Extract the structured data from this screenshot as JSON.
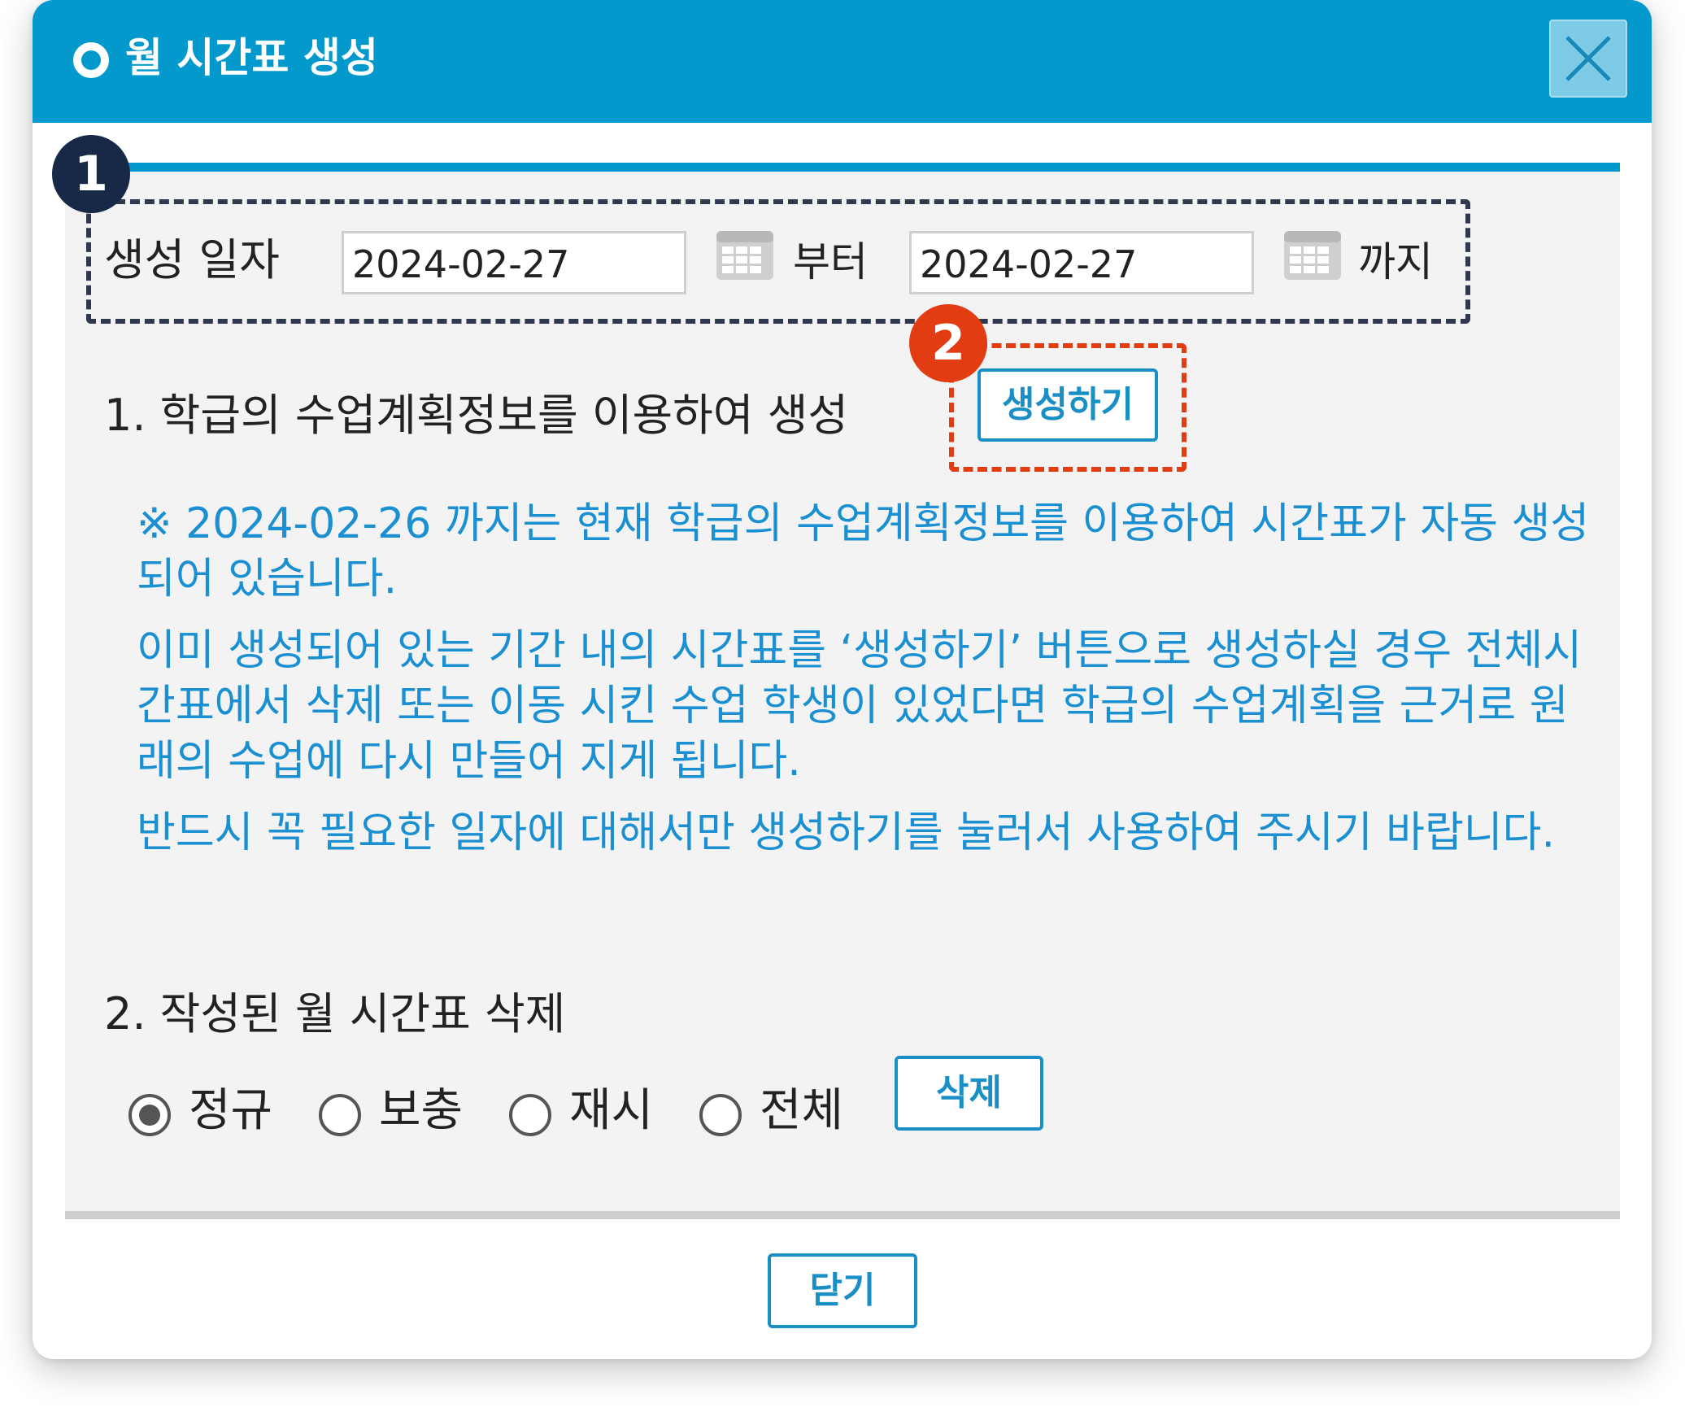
{
  "dialog": {
    "title": "월 시간표 생성",
    "close_icon": "close-icon"
  },
  "badges": {
    "first": "1",
    "second": "2"
  },
  "date_range": {
    "label": "생성 일자",
    "start_value": "2024-02-27",
    "from_label": "부터",
    "end_value": "2024-02-27",
    "to_label": "까지",
    "calendar_icon": "calendar-icon"
  },
  "section1": {
    "title": "1. 학급의 수업계획정보를 이용하여 생성",
    "create_button": "생성하기",
    "notices": [
      "※ 2024-02-26 까지는 현재 학급의 수업계획정보를 이용하여 시간표가 자동 생성되어 있습니다.",
      "이미 생성되어 있는 기간 내의 시간표를 ‘생성하기’ 버튼으로 생성하실 경우 전체시간표에서 삭제 또는 이동 시킨 수업 학생이 있었다면 학급의 수업계획을 근거로 원래의 수업에 다시 만들어 지게 됩니다.",
      "반드시 꼭 필요한 일자에 대해서만 생성하기를 눌러서 사용하여 주시기 바랍니다."
    ]
  },
  "section2": {
    "title": "2. 작성된 월 시간표 삭제",
    "options": [
      "정규",
      "보충",
      "재시",
      "전체"
    ],
    "selected": "정규",
    "delete_button": "삭제"
  },
  "footer": {
    "close_button": "닫기"
  },
  "colors": {
    "header": "#0399cc",
    "accent_blue": "#1a8fd1",
    "badge_dark": "#172947",
    "badge_red": "#e23c12",
    "panel": "#f3f3f3"
  }
}
